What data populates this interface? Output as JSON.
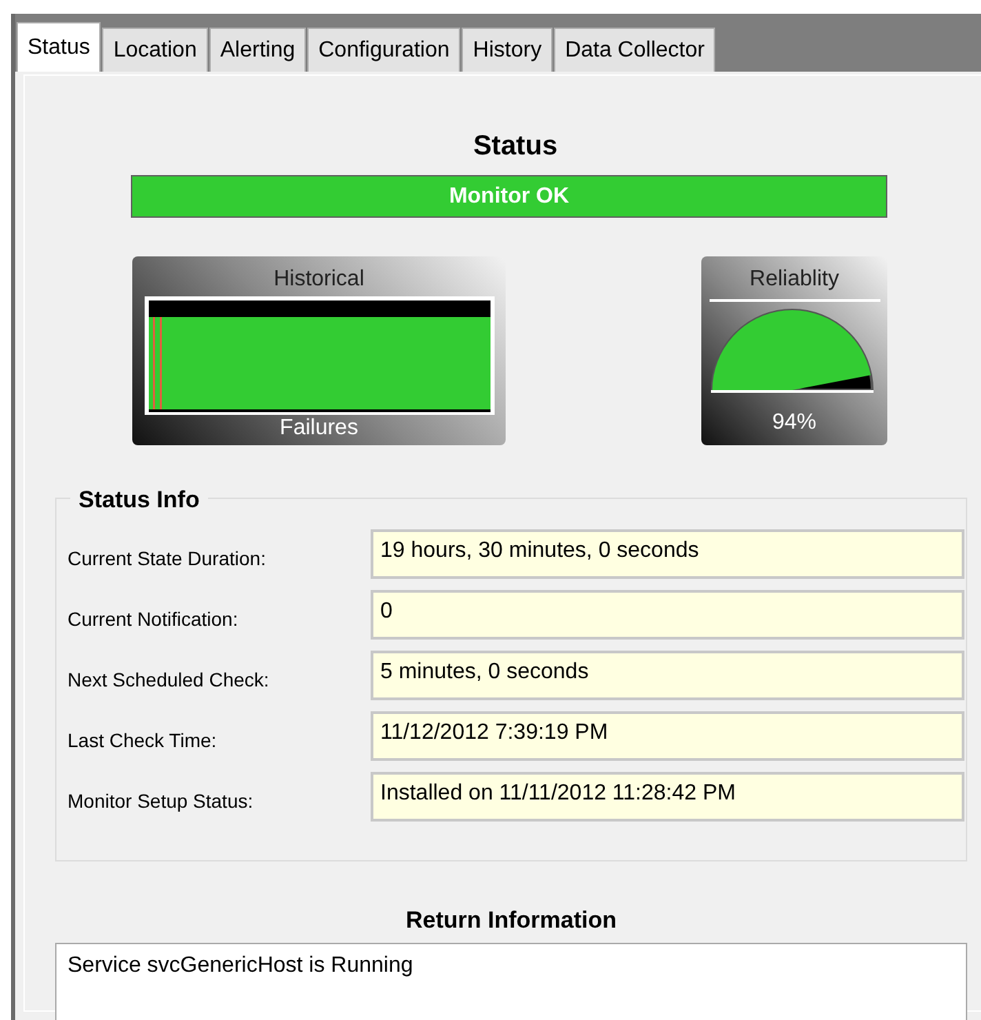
{
  "tabs": [
    {
      "label": "Status",
      "selected": true
    },
    {
      "label": "Location",
      "selected": false
    },
    {
      "label": "Alerting",
      "selected": false
    },
    {
      "label": "Configuration",
      "selected": false
    },
    {
      "label": "History",
      "selected": false
    },
    {
      "label": "Data Collector",
      "selected": false
    }
  ],
  "status": {
    "title": "Status",
    "banner": "Monitor OK"
  },
  "historical": {
    "title": "Historical",
    "caption": "Failures"
  },
  "reliability": {
    "title": "Reliablity",
    "level": 0.94,
    "reading": "94%"
  },
  "status_info": {
    "title": "Status Info",
    "fields": [
      {
        "label": "Current State Duration:",
        "value": "19 hours, 30 minutes, 0 seconds"
      },
      {
        "label": "Current Notification:",
        "value": "0"
      },
      {
        "label": "Next Scheduled Check:",
        "value": "5 minutes, 0 seconds"
      },
      {
        "label": "Last Check Time:",
        "value": "11/12/2012 7:39:19 PM"
      },
      {
        "label": "Monitor Setup Status:",
        "value": "Installed on 11/11/2012 11:28:42 PM"
      }
    ]
  },
  "return_information": {
    "title": "Return Information",
    "text": "Service svcGenericHost is Running"
  }
}
